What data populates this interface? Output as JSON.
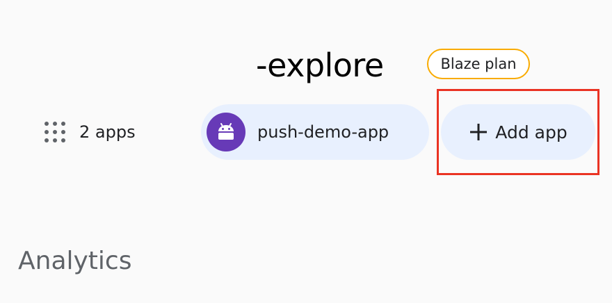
{
  "header": {
    "project_title": "-explore",
    "plan_badge": "Blaze plan"
  },
  "apps": {
    "count_label": "2 apps",
    "count_icon": "apps-grid-icon",
    "items": [
      {
        "label": "push-demo-app",
        "platform_icon": "android-icon",
        "avatar_color": "#673ab7"
      }
    ],
    "add_button_label": "Add app",
    "add_button_icon": "plus-icon"
  },
  "sections": {
    "analytics_title": "Analytics"
  },
  "colors": {
    "chip_background": "#e8f0fe",
    "badge_border": "#f9ab00",
    "highlight_border": "#ea3323",
    "page_background": "#fafafa"
  }
}
